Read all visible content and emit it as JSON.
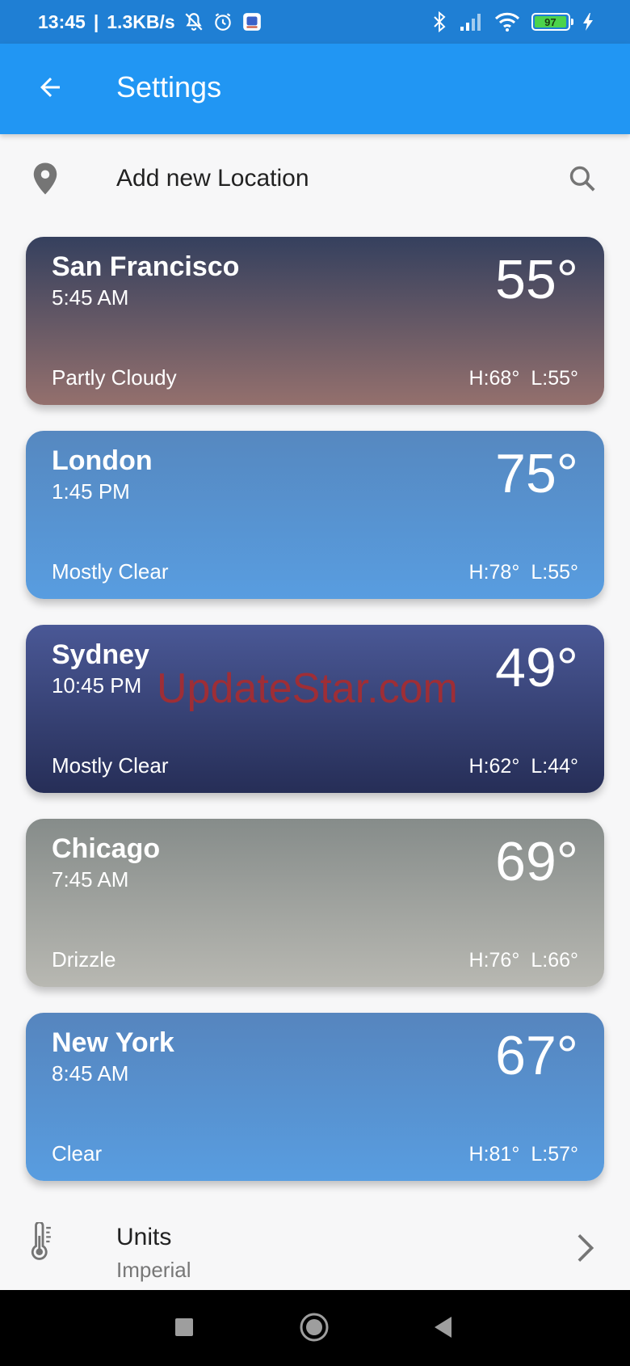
{
  "status_bar": {
    "time": "13:45",
    "speed": "1.3KB/s",
    "battery_level": "97",
    "icons": [
      "mute-icon",
      "alarm-icon",
      "app-icon",
      "bluetooth-icon",
      "signal-icon",
      "wifi-icon",
      "battery-icon",
      "charging-icon"
    ]
  },
  "app_bar": {
    "title": "Settings",
    "back_icon": "arrow-back-icon",
    "color": "#2196f3"
  },
  "add_location": {
    "label": "Add new Location",
    "icon": "location-pin-icon",
    "action_icon": "search-icon"
  },
  "locations": [
    {
      "city": "San Francisco",
      "time": "5:45 AM",
      "temperature": "55°",
      "condition": "Partly Cloudy",
      "high": "H:68°",
      "low": "L:55°",
      "gradient": [
        "#35405e",
        "#94706d"
      ]
    },
    {
      "city": "London",
      "time": "1:45 PM",
      "temperature": "75°",
      "condition": "Mostly Clear",
      "high": "H:78°",
      "low": "L:55°",
      "gradient": [
        "#5688c0",
        "#589de0"
      ]
    },
    {
      "city": "Sydney",
      "time": "10:45 PM",
      "temperature": "49°",
      "condition": "Mostly Clear",
      "high": "H:62°",
      "low": "L:44°",
      "gradient": [
        "#4a5896",
        "#262e57"
      ]
    },
    {
      "city": "Chicago",
      "time": "7:45 AM",
      "temperature": "69°",
      "condition": "Drizzle",
      "high": "H:76°",
      "low": "L:66°",
      "gradient": [
        "#868c8a",
        "#b8b8b2"
      ]
    },
    {
      "city": "New York",
      "time": "8:45 AM",
      "temperature": "67°",
      "condition": "Clear",
      "high": "H:81°",
      "low": "L:57°",
      "gradient": [
        "#5685be",
        "#589de0"
      ]
    }
  ],
  "watermark": "UpdateStar.com",
  "units": {
    "label": "Units",
    "value": "Imperial",
    "icon": "thermometer-icon",
    "chevron": "chevron-right-icon"
  },
  "nav_bar": {
    "buttons": [
      "recents-icon",
      "home-icon",
      "back-icon"
    ]
  }
}
